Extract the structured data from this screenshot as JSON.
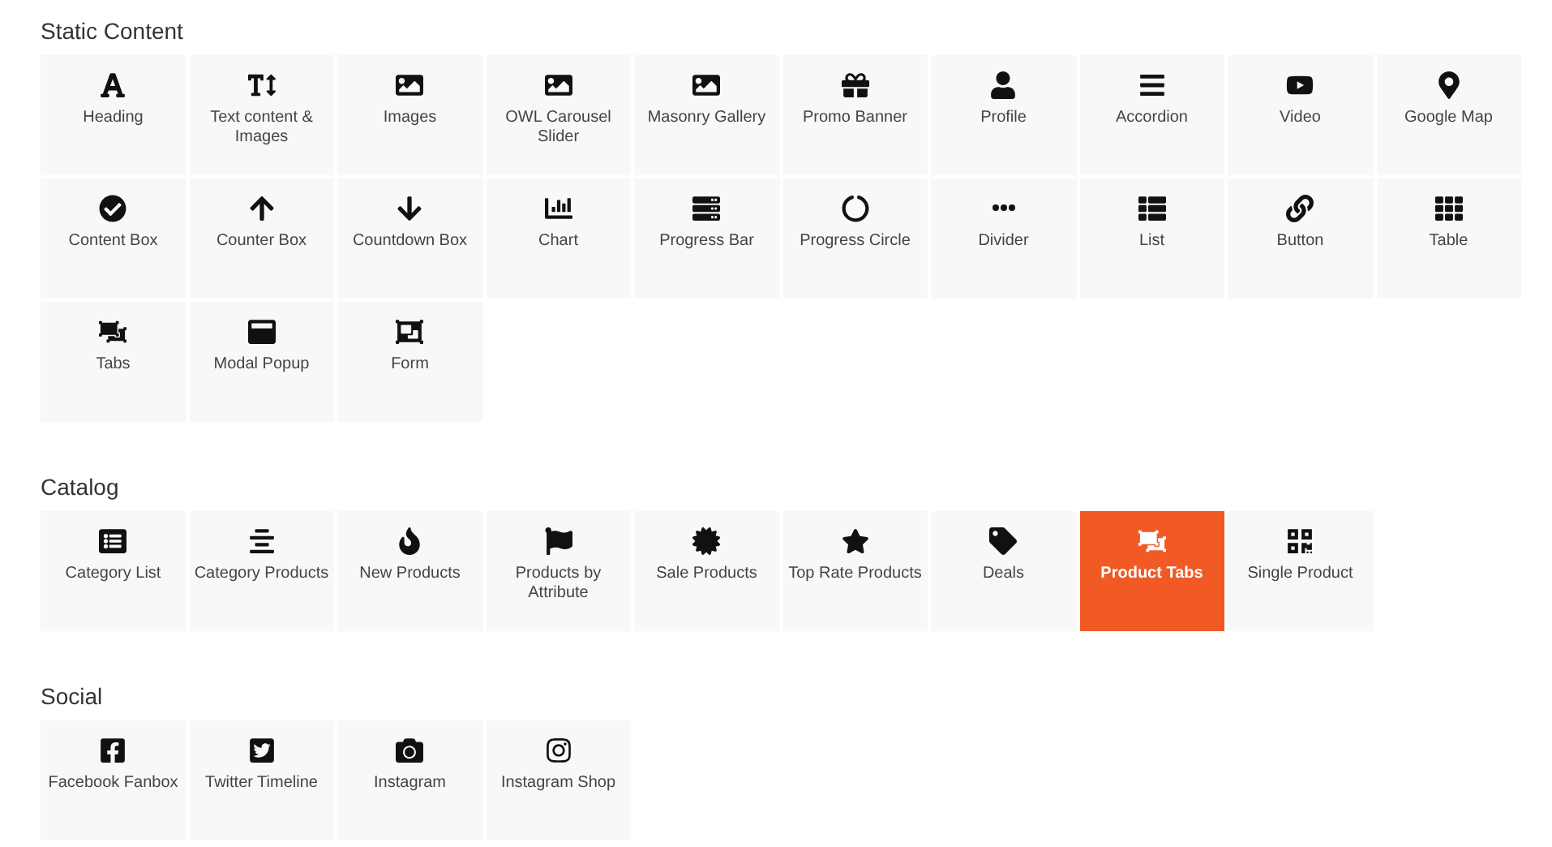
{
  "sections": [
    {
      "title": "Static Content",
      "items": [
        {
          "label": "Heading",
          "selected": false
        },
        {
          "label": "Text content & Images",
          "selected": false
        },
        {
          "label": "Images",
          "selected": false
        },
        {
          "label": "OWL Carousel Slider",
          "selected": false
        },
        {
          "label": "Masonry Gallery",
          "selected": false
        },
        {
          "label": "Promo Banner",
          "selected": false
        },
        {
          "label": "Profile",
          "selected": false
        },
        {
          "label": "Accordion",
          "selected": false
        },
        {
          "label": "Video",
          "selected": false
        },
        {
          "label": "Google Map",
          "selected": false
        },
        {
          "label": "Content Box",
          "selected": false
        },
        {
          "label": "Counter Box",
          "selected": false
        },
        {
          "label": "Countdown Box",
          "selected": false
        },
        {
          "label": "Chart",
          "selected": false
        },
        {
          "label": "Progress Bar",
          "selected": false
        },
        {
          "label": "Progress Circle",
          "selected": false
        },
        {
          "label": "Divider",
          "selected": false
        },
        {
          "label": "List",
          "selected": false
        },
        {
          "label": "Button",
          "selected": false
        },
        {
          "label": "Table",
          "selected": false
        },
        {
          "label": "Tabs",
          "selected": false
        },
        {
          "label": "Modal Popup",
          "selected": false
        },
        {
          "label": "Form",
          "selected": false
        }
      ]
    },
    {
      "title": "Catalog",
      "items": [
        {
          "label": "Category List",
          "selected": false
        },
        {
          "label": "Category Products",
          "selected": false
        },
        {
          "label": "New Products",
          "selected": false
        },
        {
          "label": "Products by Attribute",
          "selected": false
        },
        {
          "label": "Sale Products",
          "selected": false
        },
        {
          "label": "Top Rate Products",
          "selected": false
        },
        {
          "label": "Deals",
          "selected": false
        },
        {
          "label": "Product Tabs",
          "selected": true
        },
        {
          "label": "Single Product",
          "selected": false
        }
      ]
    },
    {
      "title": "Social",
      "items": [
        {
          "label": "Facebook Fanbox",
          "selected": false
        },
        {
          "label": "Twitter Timeline",
          "selected": false
        },
        {
          "label": "Instagram",
          "selected": false
        },
        {
          "label": "Instagram Shop",
          "selected": false
        }
      ]
    }
  ]
}
